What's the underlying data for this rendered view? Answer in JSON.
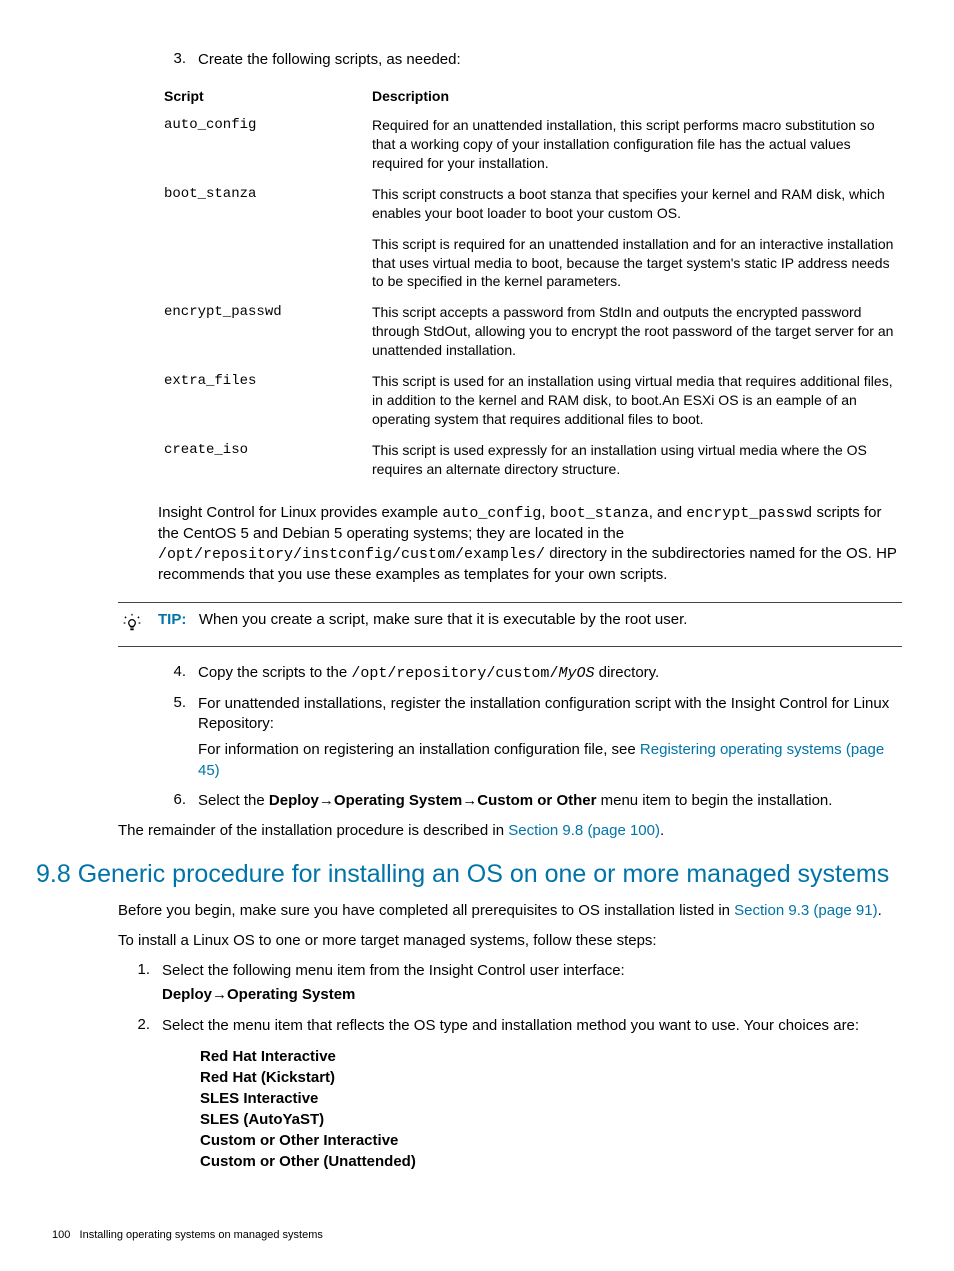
{
  "step3": {
    "num": "3.",
    "text": "Create the following scripts, as needed:"
  },
  "table": {
    "h1": "Script",
    "h2": "Description",
    "rows": [
      {
        "script": "auto_config",
        "desc": [
          "Required for an unattended installation, this script performs macro substitution so that a working copy of your installation configuration file has the actual values required for your installation."
        ]
      },
      {
        "script": "boot_stanza",
        "desc": [
          "This script constructs a boot stanza that specifies your kernel and RAM disk, which enables your boot loader to boot your custom OS.",
          "This script is required for an unattended installation and for an interactive installation that uses virtual media to boot, because the target system's static IP address needs to be specified in the kernel parameters."
        ]
      },
      {
        "script": "encrypt_passwd",
        "desc": [
          "This script accepts a password from StdIn and outputs the encrypted password through StdOut, allowing you to encrypt the root password of the target server for an unattended installation."
        ]
      },
      {
        "script": "extra_files",
        "desc": [
          "This script is used for an installation using virtual media that requires additional files, in addition to the kernel and RAM disk, to boot.An ESXi OS is an eample of an operating system that requires additional files to boot."
        ]
      },
      {
        "script": "create_iso",
        "desc": [
          "This script is used expressly for an installation using virtual media where the OS requires an alternate directory structure."
        ]
      }
    ]
  },
  "insight": {
    "pre": "Insight Control for Linux provides example ",
    "s1": "auto_config",
    "sep1": ", ",
    "s2": "boot_stanza",
    "sep2": ", and ",
    "s3": "encrypt_passwd",
    "post1": " scripts for the CentOS 5 and Debian 5 operating systems; they are located in the ",
    "path": "/opt/repository/instconfig/custom/examples/",
    "post2": " directory in the subdirectories named for the OS. HP recommends that you use these examples as templates for your own scripts."
  },
  "tip": {
    "label": "TIP:",
    "text": "When you create a script, make sure that it is executable by the root user."
  },
  "step4": {
    "num": "4.",
    "pre": "Copy the scripts to the ",
    "path1": "/opt/repository/custom/",
    "path2": "MyOS",
    "post": " directory."
  },
  "step5": {
    "num": "5.",
    "text": "For unattended installations, register the installation configuration script with the Insight Control for Linux Repository:",
    "p2a": "For information on registering an installation configuration file, see ",
    "link": "Registering operating systems (page 45)"
  },
  "step6": {
    "num": "6.",
    "pre": "Select the ",
    "menu": "Deploy→Operating System→Custom or Other",
    "post": " menu item to begin the installation."
  },
  "remainder": {
    "pre": "The remainder of the installation procedure is described in ",
    "link": "Section 9.8 (page 100)",
    "post": "."
  },
  "heading": "9.8 Generic procedure for installing an OS on one or more managed systems",
  "before": {
    "pre": "Before you begin, make sure you have completed all prerequisites to OS installation listed in ",
    "link": "Section 9.3 (page 91)",
    "post": "."
  },
  "toinstall": "To install a Linux OS to one or more target managed systems, follow these steps:",
  "b1": {
    "num": "1.",
    "text": "Select the following menu item from the Insight Control user interface:",
    "menu": "Deploy→Operating System"
  },
  "b2": {
    "num": "2.",
    "text": "Select the menu item that reflects the OS type and installation method you want to use. Your choices are:",
    "opts": [
      "Red Hat Interactive",
      "Red Hat (Kickstart)",
      "SLES Interactive",
      "SLES (AutoYaST)",
      "Custom or Other Interactive",
      "Custom or Other (Unattended)"
    ]
  },
  "footer": {
    "page": "100",
    "title": "Installing operating systems on managed systems"
  }
}
